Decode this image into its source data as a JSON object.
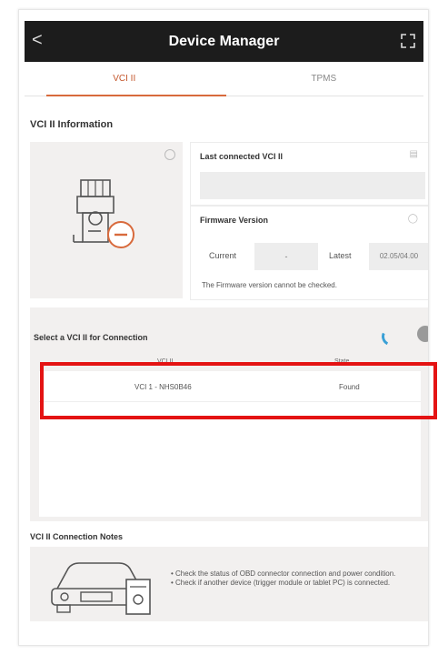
{
  "header": {
    "title": "Device Manager",
    "back_glyph": "<"
  },
  "tabs": [
    {
      "label": "VCI II",
      "active": true
    },
    {
      "label": "TPMS",
      "active": false
    }
  ],
  "vci_info": {
    "section_title": "VCI II Information",
    "last_connected_label": "Last connected VCI II",
    "last_connected_value": "",
    "firmware_label": "Firmware Version",
    "current_label": "Current",
    "current_value": "-",
    "latest_label": "Latest",
    "latest_value": "02.05/04.00",
    "firmware_note": "The Firmware version cannot be checked."
  },
  "selection": {
    "title": "Select a VCI II for Connection",
    "columns": [
      "VCI II",
      "State"
    ],
    "rows": [
      {
        "name": "VCI 1 - NHS0B46",
        "state": "Found"
      }
    ]
  },
  "notes": {
    "title": "VCI II Connection Notes",
    "line1": "• Check the status of OBD connector connection and power condition.",
    "line2": "• Check if another device (trigger module or tablet PC) is connected."
  },
  "colors": {
    "accent": "#d86a3c",
    "topbar": "#1c1c1c",
    "highlight": "#e41313",
    "spinner": "#3aa0d6"
  },
  "icons": [
    "back-icon",
    "expand-icon",
    "gear-icon",
    "vci-device-icon",
    "edit-icon",
    "info-icon",
    "spinner-icon",
    "refresh-icon",
    "car-vci-icon"
  ]
}
